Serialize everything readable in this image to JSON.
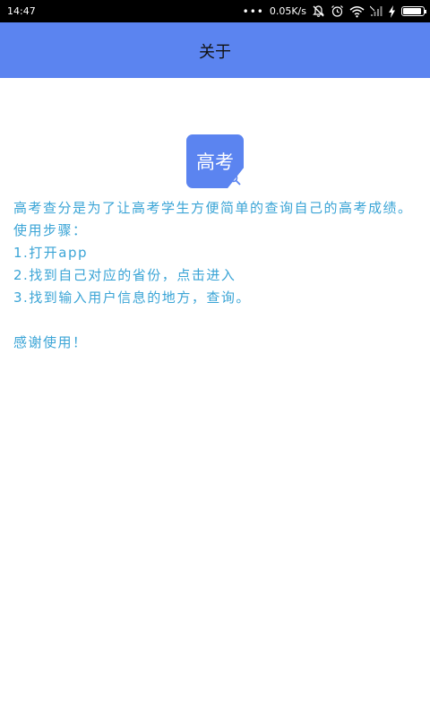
{
  "status_bar": {
    "time": "14:47",
    "dots": "•••",
    "net_speed": "0.05K/s"
  },
  "header": {
    "title": "关于"
  },
  "logo": {
    "text": "高考",
    "icon": "magnifier-icon"
  },
  "content": {
    "intro": "高考查分是为了让高考学生方便简单的查询自己的高考成绩。使用步骤：",
    "steps": [
      "1.打开app",
      "2.找到自己对应的省份，点击进入",
      "3.找到输入用户信息的地方，查询。"
    ],
    "thanks": "感谢使用！"
  },
  "colors": {
    "accent": "#5b84f0",
    "text": "#3aa4d6",
    "status_bar": "#000000"
  }
}
